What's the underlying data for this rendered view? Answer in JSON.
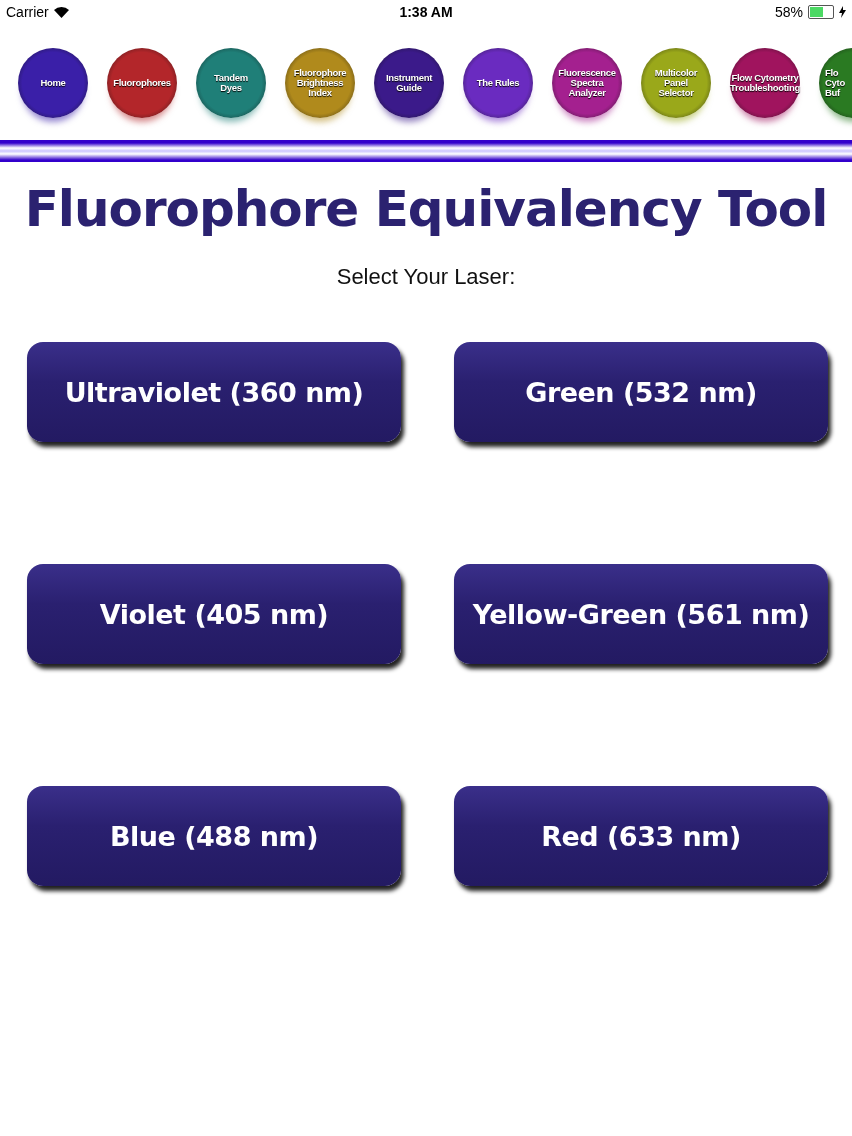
{
  "status_bar": {
    "carrier": "Carrier",
    "time": "1:38 AM",
    "battery_text": "58%",
    "battery": {
      "level": 0.58
    },
    "charging": true
  },
  "nav": [
    {
      "lines": [
        "Home"
      ],
      "color": "#3a1fa8",
      "cut": false
    },
    {
      "lines": [
        "Fluorophores"
      ],
      "color": "#b3262a",
      "cut": false
    },
    {
      "lines": [
        "Tandem",
        "Dyes"
      ],
      "color": "#1f7f78",
      "cut": false
    },
    {
      "lines": [
        "Fluorophore",
        "Brightness",
        "Index"
      ],
      "color": "#b08a1c",
      "cut": false
    },
    {
      "lines": [
        "Instrument",
        "Guide"
      ],
      "color": "#3b1a8a",
      "cut": false
    },
    {
      "lines": [
        "The Rules"
      ],
      "color": "#6a2bc0",
      "cut": false
    },
    {
      "lines": [
        "Fluorescence",
        "Spectra",
        "Analyzer"
      ],
      "color": "#a4208f",
      "cut": false
    },
    {
      "lines": [
        "Multicolor",
        "Panel",
        "Selector"
      ],
      "color": "#9aa81a",
      "cut": false
    },
    {
      "lines": [
        "Flow Cytometry",
        "Troubleshooting"
      ],
      "color": "#a0145e",
      "cut": false
    },
    {
      "lines": [
        "Flo",
        "Cyto",
        "Buf"
      ],
      "color": "#2a7a22",
      "cut": true
    }
  ],
  "title": "Fluorophore Equivalency Tool",
  "prompt": "Select Your Laser:",
  "lasers": [
    "Ultraviolet (360 nm)",
    "Green (532 nm)",
    "Violet (405 nm)",
    "Yellow-Green (561 nm)",
    "Blue (488 nm)",
    "Red (633 nm)"
  ]
}
